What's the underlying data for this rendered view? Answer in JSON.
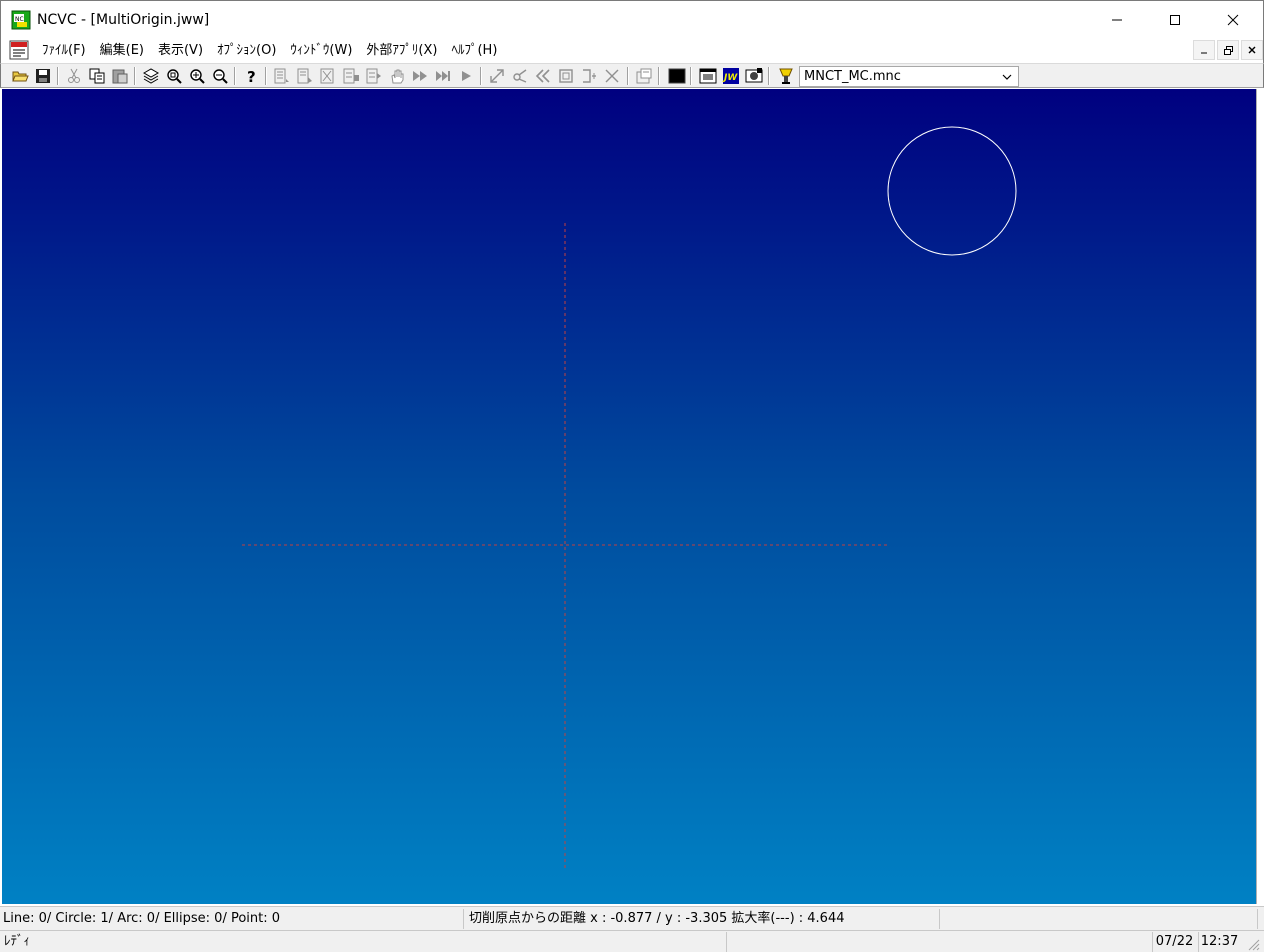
{
  "window": {
    "title": "NCVC - [MultiOrigin.jww]",
    "controls": {
      "minimize": "minimize-icon",
      "maximize": "maximize-icon",
      "close": "close-icon"
    }
  },
  "menubar": {
    "items": [
      {
        "label": "ﾌｧｲﾙ(F)"
      },
      {
        "label": "編集(E)"
      },
      {
        "label": "表示(V)"
      },
      {
        "label": "ｵﾌﾟｼｮﾝ(O)"
      },
      {
        "label": "ｳｨﾝﾄﾞｳ(W)"
      },
      {
        "label": "外部ｱﾌﾟﾘ(X)"
      },
      {
        "label": "ﾍﾙﾌﾟ(H)"
      }
    ]
  },
  "toolbar": {
    "machine_combo_value": "MNCT_MC.mnc"
  },
  "status": {
    "counts": "Line:     0/ Circle:     1/ Arc:     0/ Ellipse:     0/ Point:     0",
    "distance": "切削原点からの距離  x : -0.877 / y : -3.305",
    "zoom": "拡大率(---) :  4.644",
    "ready": "ﾚﾃﾞｨ",
    "date": "07/22",
    "time": "12:37"
  },
  "colors": {
    "canvas_top": "#000080",
    "canvas_bottom": "#0081c4",
    "origin_lines": "#c04040",
    "circle": "#ffffff"
  }
}
